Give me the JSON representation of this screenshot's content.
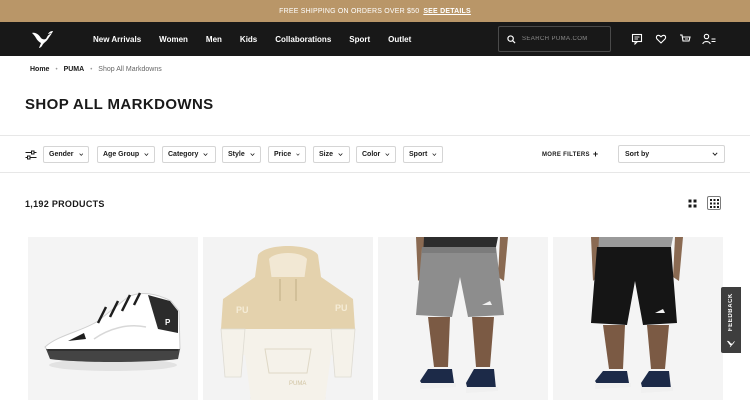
{
  "promo": {
    "text": "FREE SHIPPING ON ORDERS OVER $50",
    "link": "SEE DETAILS"
  },
  "nav": {
    "links": [
      "New Arrivals",
      "Women",
      "Men",
      "Kids",
      "Collaborations",
      "Sport",
      "Outlet"
    ],
    "search_placeholder": "SEARCH PUMA.COM",
    "icons": [
      "chat-icon",
      "heart-icon",
      "cart-icon",
      "account-icon"
    ]
  },
  "breadcrumb": {
    "items": [
      "Home",
      "PUMA"
    ],
    "current": "Shop All Markdowns"
  },
  "page_title": "SHOP ALL MARKDOWNS",
  "filters": [
    "Gender",
    "Age Group",
    "Category",
    "Style",
    "Price",
    "Size",
    "Color",
    "Sport"
  ],
  "more_filters": "MORE FILTERS",
  "sort": {
    "label": "Sort by"
  },
  "results_count": "1,192 PRODUCTS",
  "products": [
    {
      "name": "white-sneaker"
    },
    {
      "name": "cream-hoodie"
    },
    {
      "name": "grey-shorts"
    },
    {
      "name": "black-shorts"
    }
  ],
  "feedback_label": "FEEDBACK",
  "colors": {
    "promo_bar": "#b99668",
    "nav_bar": "#181818",
    "feedback_tab": "#3e3e3e"
  }
}
